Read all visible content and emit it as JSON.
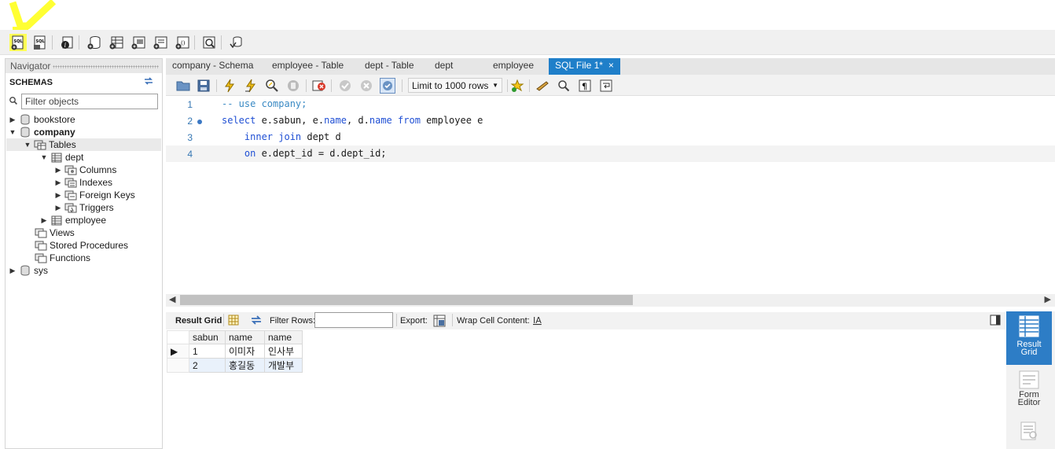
{
  "main_toolbar": {
    "icons": [
      "new-sql-tab-icon",
      "open-sql-script-icon",
      "inspector-icon",
      "create-schema-icon",
      "create-table-icon",
      "create-view-icon",
      "create-procedure-icon",
      "create-function-icon",
      "search-table-data-icon",
      "reconnect-icon"
    ]
  },
  "navigator": {
    "title": "Navigator",
    "schemas_label": "SCHEMAS",
    "filter_placeholder": "Filter objects",
    "tree": {
      "bookstore": "bookstore",
      "company": "company",
      "tables": "Tables",
      "dept": "dept",
      "columns": "Columns",
      "indexes": "Indexes",
      "foreign_keys": "Foreign Keys",
      "triggers": "Triggers",
      "employee": "employee",
      "views": "Views",
      "stored_procedures": "Stored Procedures",
      "functions": "Functions",
      "sys": "sys"
    }
  },
  "tabs": [
    {
      "label": "company - Schema"
    },
    {
      "label": "employee - Table"
    },
    {
      "label": "dept - Table"
    },
    {
      "label": "dept"
    },
    {
      "label": "employee"
    },
    {
      "label": "SQL File 1*",
      "close": "×"
    }
  ],
  "sql_toolbar": {
    "limit": "Limit to 1000 rows"
  },
  "editor": {
    "lines": [
      {
        "num": "1",
        "parts": [
          {
            "t": "-- use company;",
            "c": "cm"
          }
        ]
      },
      {
        "num": "2",
        "parts": [
          {
            "t": "select",
            "c": "kw"
          },
          {
            "t": " e.sabun, e.",
            "c": ""
          },
          {
            "t": "name",
            "c": "kw"
          },
          {
            "t": ", d.",
            "c": ""
          },
          {
            "t": "name",
            "c": "kw"
          },
          {
            "t": " ",
            "c": ""
          },
          {
            "t": "from",
            "c": "kw"
          },
          {
            "t": " employee e",
            "c": ""
          }
        ]
      },
      {
        "num": "3",
        "parts": [
          {
            "t": "    ",
            "c": ""
          },
          {
            "t": "inner join",
            "c": "kw"
          },
          {
            "t": " dept d",
            "c": ""
          }
        ]
      },
      {
        "num": "4",
        "parts": [
          {
            "t": "    ",
            "c": ""
          },
          {
            "t": "on",
            "c": "kw"
          },
          {
            "t": " e.dept_id = d.dept_id;",
            "c": ""
          }
        ]
      }
    ]
  },
  "result_toolbar": {
    "result_grid": "Result Grid",
    "filter_rows": "Filter Rows:",
    "export": "Export:",
    "wrap_cell": "Wrap Cell Content:"
  },
  "result_grid": {
    "columns": [
      "sabun",
      "name",
      "name"
    ],
    "rows": [
      [
        "1",
        "이미자",
        "인사부"
      ],
      [
        "2",
        "홍길동",
        "개발부"
      ]
    ]
  },
  "right_panel": {
    "result_grid": "Result\nGrid",
    "form_editor": "Form\nEditor"
  },
  "colors": {
    "accent": "#1f7fc9",
    "keyword": "#1f4fd4",
    "comment": "#3a8ac4",
    "highlight_yellow": "#ffff33"
  }
}
